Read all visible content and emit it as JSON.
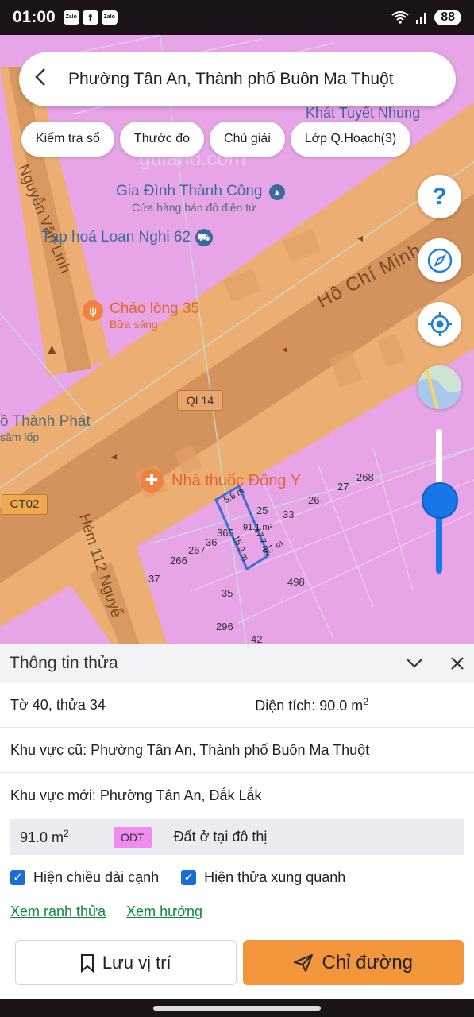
{
  "status": {
    "time": "01:00",
    "apps": [
      "Zalo",
      "f",
      "Zalo"
    ],
    "battery": "88"
  },
  "search": {
    "title": "Phường Tân An, Thành phố Buôn Ma Thuột"
  },
  "chips": [
    "Kiểm tra sổ",
    "Thước đo",
    "Chú giải",
    "Lớp Q.Hoạch(3)"
  ],
  "fabs": {
    "help": "?"
  },
  "map": {
    "streets": [
      "Hồ Chí Minh",
      "Nguyễn Văn Linh",
      "Hẻm 112 Nguyễ"
    ],
    "road_badges": [
      "QL14",
      "CT02"
    ],
    "pois": [
      "Khát Tuyết Nhung",
      "Gia Đình Thành Công",
      "Cửa hàng bán đồ điện tử",
      "Tạp hoá Loan Nghi 62",
      "Cháo lòng 35",
      "Bữa sáng",
      "ồ Thành Phát",
      "săm lốp",
      "Nhà thuốc Đông Y"
    ],
    "watermark": "guland.com",
    "parcel_numbers": [
      "268",
      "27",
      "26",
      "25",
      "33",
      "365",
      "36",
      "267",
      "266",
      "37",
      "35",
      "498",
      "296",
      "42"
    ],
    "dims": [
      "5.8 m",
      "91.1 m²",
      "17.7 m",
      "15.9 m",
      "5.7 m"
    ],
    "colors": {
      "residential": "#e7a5e8",
      "road_zone": "#ecae73",
      "road_core": "#d4935d",
      "parcel": "#3b6fd4"
    }
  },
  "panel": {
    "title": "Thông tin thửa",
    "sheet_parcel": "Tờ 40, thửa 34",
    "area_label": "Diện tích: 90.0 m",
    "area_sup": "2",
    "old_area": "Khu vực cũ: Phường Tân An, Thành phố Buôn Ma Thuột",
    "new_area": "Khu vực mới: Phường Tân An, Đắk Lắk",
    "land": {
      "area": "91.0 m",
      "area_sup": "2",
      "code": "ODT",
      "desc": "Đất ở tại đô thị"
    },
    "checks": [
      "Hiện chiều dài cạnh",
      "Hiện thửa xung quanh"
    ],
    "links": [
      "Xem ranh thửa",
      "Xem hướng"
    ],
    "save_label": "Lưu vị trí",
    "route_label": "Chỉ đường"
  }
}
